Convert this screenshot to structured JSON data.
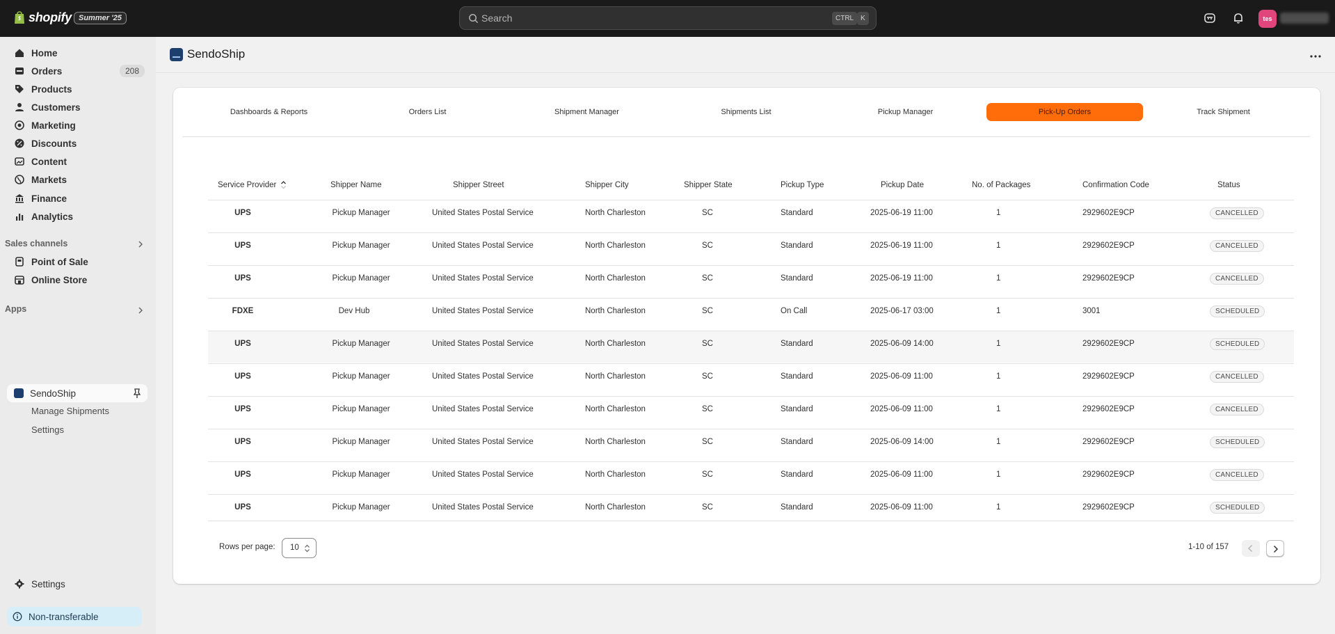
{
  "topbar": {
    "brand": "shopify",
    "edition": "Summer '25",
    "search_placeholder": "Search",
    "shortcut_ctrl": "CTRL",
    "shortcut_k": "K",
    "avatar_initials": "tes"
  },
  "sidebar": {
    "items": [
      {
        "label": "Home",
        "icon": "home-icon"
      },
      {
        "label": "Orders",
        "icon": "orders-icon",
        "count": "208"
      },
      {
        "label": "Products",
        "icon": "tag-icon"
      },
      {
        "label": "Customers",
        "icon": "person-icon"
      },
      {
        "label": "Marketing",
        "icon": "target-icon"
      },
      {
        "label": "Discounts",
        "icon": "discount-icon"
      },
      {
        "label": "Content",
        "icon": "content-icon"
      },
      {
        "label": "Markets",
        "icon": "globe-icon"
      },
      {
        "label": "Finance",
        "icon": "bank-icon"
      },
      {
        "label": "Analytics",
        "icon": "bar-chart-icon"
      }
    ],
    "sales_channels_heading": "Sales channels",
    "channels": [
      {
        "label": "Point of Sale",
        "icon": "pos-icon"
      },
      {
        "label": "Online Store",
        "icon": "store-icon"
      }
    ],
    "apps_heading": "Apps",
    "app": {
      "label": "SendoShip",
      "sub_items": [
        "Manage Shipments",
        "Settings"
      ]
    },
    "settings_label": "Settings",
    "non_transferable_label": "Non-transferable"
  },
  "app_header": {
    "title": "SendoShip"
  },
  "tabs": [
    "Dashboards & Reports",
    "Orders List",
    "Shipment Manager",
    "Shipments List",
    "Pickup Manager",
    "Pick-Up Orders",
    "Track Shipment"
  ],
  "active_tab": "Pick-Up Orders",
  "accent_color": "#ff6d0b",
  "table": {
    "columns": [
      "Service Provider",
      "Shipper Name",
      "Shipper Street",
      "Shipper City",
      "Shipper State",
      "Pickup Type",
      "Pickup Date",
      "No. of Packages",
      "Confirmation Code",
      "Status"
    ],
    "rows": [
      [
        "UPS",
        "Pickup Manager",
        "United States Postal Service",
        "North Charleston",
        "SC",
        "Standard",
        "2025-06-19 11:00",
        "1",
        "2929602E9CP",
        "CANCELLED"
      ],
      [
        "UPS",
        "Pickup Manager",
        "United States Postal Service",
        "North Charleston",
        "SC",
        "Standard",
        "2025-06-19 11:00",
        "1",
        "2929602E9CP",
        "CANCELLED"
      ],
      [
        "UPS",
        "Pickup Manager",
        "United States Postal Service",
        "North Charleston",
        "SC",
        "Standard",
        "2025-06-19 11:00",
        "1",
        "2929602E9CP",
        "CANCELLED"
      ],
      [
        "FDXE",
        "Dev Hub",
        "United States Postal Service",
        "North Charleston",
        "SC",
        "On Call",
        "2025-06-17 03:00",
        "1",
        "3001",
        "SCHEDULED"
      ],
      [
        "UPS",
        "Pickup Manager",
        "United States Postal Service",
        "North Charleston",
        "SC",
        "Standard",
        "2025-06-09 14:00",
        "1",
        "2929602E9CP",
        "SCHEDULED"
      ],
      [
        "UPS",
        "Pickup Manager",
        "United States Postal Service",
        "North Charleston",
        "SC",
        "Standard",
        "2025-06-09 11:00",
        "1",
        "2929602E9CP",
        "CANCELLED"
      ],
      [
        "UPS",
        "Pickup Manager",
        "United States Postal Service",
        "North Charleston",
        "SC",
        "Standard",
        "2025-06-09 11:00",
        "1",
        "2929602E9CP",
        "CANCELLED"
      ],
      [
        "UPS",
        "Pickup Manager",
        "United States Postal Service",
        "North Charleston",
        "SC",
        "Standard",
        "2025-06-09 14:00",
        "1",
        "2929602E9CP",
        "SCHEDULED"
      ],
      [
        "UPS",
        "Pickup Manager",
        "United States Postal Service",
        "North Charleston",
        "SC",
        "Standard",
        "2025-06-09 11:00",
        "1",
        "2929602E9CP",
        "CANCELLED"
      ],
      [
        "UPS",
        "Pickup Manager",
        "United States Postal Service",
        "North Charleston",
        "SC",
        "Standard",
        "2025-06-09 11:00",
        "1",
        "2929602E9CP",
        "SCHEDULED"
      ]
    ]
  },
  "pagination": {
    "rows_per_page_label": "Rows per page:",
    "rows_per_page_value": "10",
    "range_text": "1-10 of 157"
  }
}
